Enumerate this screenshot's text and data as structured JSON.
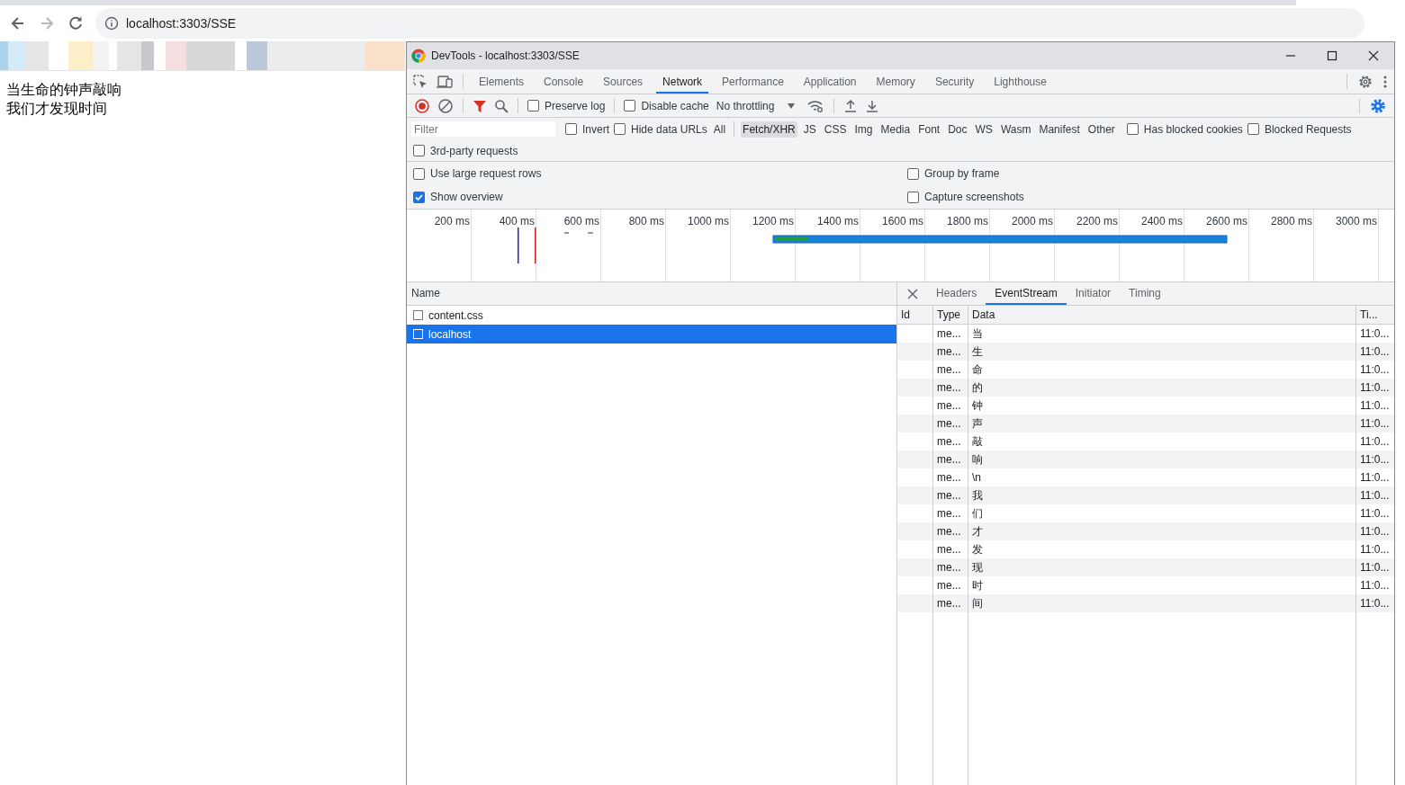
{
  "browser": {
    "address": "localhost:3303/SSE"
  },
  "page": {
    "lines": [
      "当生命的钟声敲响",
      "我们才发现时间"
    ]
  },
  "devtools": {
    "title": "DevTools - localhost:3303/SSE",
    "tabs": [
      {
        "label": "Elements",
        "selected": false
      },
      {
        "label": "Console",
        "selected": false
      },
      {
        "label": "Sources",
        "selected": false
      },
      {
        "label": "Network",
        "selected": true
      },
      {
        "label": "Performance",
        "selected": false
      },
      {
        "label": "Application",
        "selected": false
      },
      {
        "label": "Memory",
        "selected": false
      },
      {
        "label": "Security",
        "selected": false
      },
      {
        "label": "Lighthouse",
        "selected": false
      }
    ],
    "toolbar": {
      "recording": true,
      "preserve_log": {
        "label": "Preserve log",
        "checked": false
      },
      "disable_cache": {
        "label": "Disable cache",
        "checked": false
      },
      "throttling": "No throttling"
    },
    "filter": {
      "placeholder": "Filter",
      "invert": {
        "label": "Invert",
        "checked": false
      },
      "hide_data_urls": {
        "label": "Hide data URLs",
        "checked": false
      },
      "types": [
        {
          "label": "All",
          "selected": false
        },
        {
          "label": "Fetch/XHR",
          "selected": true
        },
        {
          "label": "JS",
          "selected": false
        },
        {
          "label": "CSS",
          "selected": false
        },
        {
          "label": "Img",
          "selected": false
        },
        {
          "label": "Media",
          "selected": false
        },
        {
          "label": "Font",
          "selected": false
        },
        {
          "label": "Doc",
          "selected": false
        },
        {
          "label": "WS",
          "selected": false
        },
        {
          "label": "Wasm",
          "selected": false
        },
        {
          "label": "Manifest",
          "selected": false
        },
        {
          "label": "Other",
          "selected": false
        }
      ],
      "has_blocked_cookies": {
        "label": "Has blocked cookies",
        "checked": false
      },
      "blocked_requests": {
        "label": "Blocked Requests",
        "checked": false
      },
      "third_party": {
        "label": "3rd-party requests",
        "checked": false
      }
    },
    "settings": [
      {
        "label": "Use large request rows",
        "checked": false
      },
      {
        "label": "Group by frame",
        "checked": false
      },
      {
        "label": "Show overview",
        "checked": true
      },
      {
        "label": "Capture screenshots",
        "checked": false
      }
    ],
    "overview": {
      "ticks": [
        "200 ms",
        "400 ms",
        "600 ms",
        "800 ms",
        "1000 ms",
        "1200 ms",
        "1400 ms",
        "1600 ms",
        "1800 ms",
        "2000 ms",
        "2200 ms",
        "2400 ms",
        "2600 ms",
        "2800 ms",
        "3000 ms"
      ]
    },
    "requests": {
      "column": "Name",
      "rows": [
        {
          "name": "content.css",
          "selected": false
        },
        {
          "name": "localhost",
          "selected": true
        }
      ]
    },
    "detail": {
      "tabs": [
        {
          "label": "Headers",
          "selected": false
        },
        {
          "label": "EventStream",
          "selected": true
        },
        {
          "label": "Initiator",
          "selected": false
        },
        {
          "label": "Timing",
          "selected": false
        }
      ],
      "columns": [
        "Id",
        "Type",
        "Data",
        "Ti..."
      ],
      "messages": [
        {
          "type": "me...",
          "data": "当",
          "time": "11:0..."
        },
        {
          "type": "me...",
          "data": "生",
          "time": "11:0..."
        },
        {
          "type": "me...",
          "data": "命",
          "time": "11:0..."
        },
        {
          "type": "me...",
          "data": "的",
          "time": "11:0..."
        },
        {
          "type": "me...",
          "data": "钟",
          "time": "11:0..."
        },
        {
          "type": "me...",
          "data": "声",
          "time": "11:0..."
        },
        {
          "type": "me...",
          "data": "敲",
          "time": "11:0..."
        },
        {
          "type": "me...",
          "data": "响",
          "time": "11:0..."
        },
        {
          "type": "me...",
          "data": "\\n",
          "time": "11:0..."
        },
        {
          "type": "me...",
          "data": "我",
          "time": "11:0..."
        },
        {
          "type": "me...",
          "data": "们",
          "time": "11:0..."
        },
        {
          "type": "me...",
          "data": "才",
          "time": "11:0..."
        },
        {
          "type": "me...",
          "data": "发",
          "time": "11:0..."
        },
        {
          "type": "me...",
          "data": "现",
          "time": "11:0..."
        },
        {
          "type": "me...",
          "data": "时",
          "time": "11:0..."
        },
        {
          "type": "me...",
          "data": "间",
          "time": "11:0..."
        }
      ]
    }
  }
}
